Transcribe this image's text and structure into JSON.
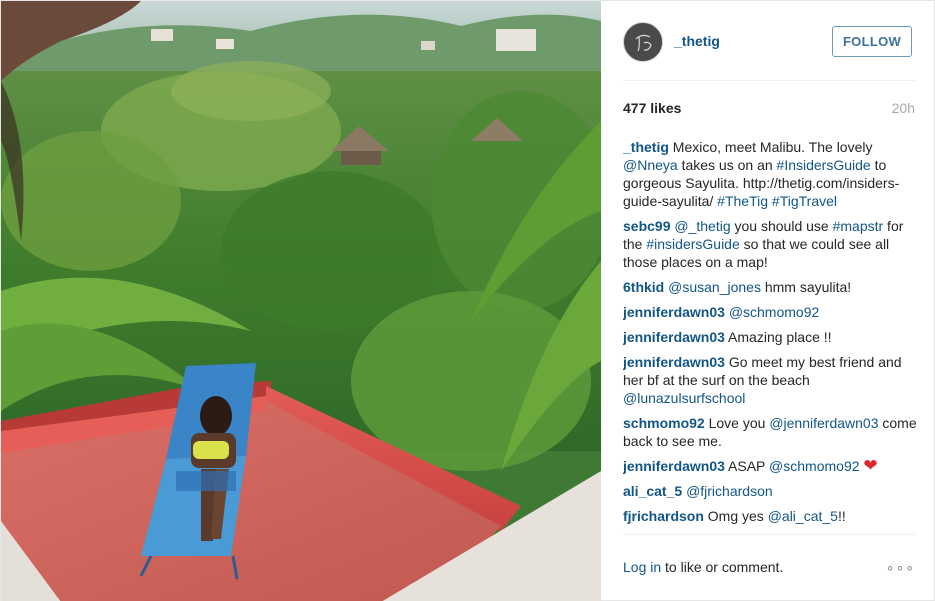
{
  "post": {
    "username": "_thetig",
    "follow_label": "FOLLOW",
    "likes": "477 likes",
    "age": "20h",
    "login_link": "Log in",
    "login_suffix": " to like or comment.",
    "more_glyph": "∘∘∘"
  },
  "comments": [
    {
      "author": "_thetig",
      "parts": [
        {
          "t": "Mexico, meet Malibu. The lovely ",
          "tag": false
        },
        {
          "t": "@Nneya",
          "tag": true
        },
        {
          "t": " takes us on an ",
          "tag": false
        },
        {
          "t": "#InsidersGuide",
          "tag": true
        },
        {
          "t": " to gorgeous Sayulita. http://thetig.com/insiders-guide-sayulita/ ",
          "tag": false
        },
        {
          "t": "#TheTig",
          "tag": true
        },
        {
          "t": " ",
          "tag": false
        },
        {
          "t": "#TigTravel",
          "tag": true
        }
      ]
    },
    {
      "author": "sebc99",
      "parts": [
        {
          "t": "@_thetig",
          "tag": true
        },
        {
          "t": " you should use ",
          "tag": false
        },
        {
          "t": "#mapstr",
          "tag": true
        },
        {
          "t": " for the ",
          "tag": false
        },
        {
          "t": "#insidersGuide",
          "tag": true
        },
        {
          "t": " so that we could see all those places on a map!",
          "tag": false
        }
      ]
    },
    {
      "author": "6thkid",
      "parts": [
        {
          "t": "@susan_jones",
          "tag": true
        },
        {
          "t": " hmm sayulita!",
          "tag": false
        }
      ]
    },
    {
      "author": "jenniferdawn03",
      "parts": [
        {
          "t": "@schmomo92",
          "tag": true
        }
      ]
    },
    {
      "author": "jenniferdawn03",
      "parts": [
        {
          "t": "Amazing place !!",
          "tag": false
        }
      ]
    },
    {
      "author": "jenniferdawn03",
      "parts": [
        {
          "t": "Go meet my best friend and her bf at the surf on the beach ",
          "tag": false
        },
        {
          "t": "@lunazulsurfschool",
          "tag": true
        }
      ]
    },
    {
      "author": "schmomo92",
      "parts": [
        {
          "t": "Love you ",
          "tag": false
        },
        {
          "t": "@jenniferdawn03",
          "tag": true
        },
        {
          "t": " come back to see me.",
          "tag": false
        }
      ]
    },
    {
      "author": "jenniferdawn03",
      "parts": [
        {
          "t": "ASAP ",
          "tag": false
        },
        {
          "t": "@schmomo92",
          "tag": true
        },
        {
          "t": " ",
          "tag": false
        },
        {
          "t": "❤",
          "tag": false,
          "heart": true
        }
      ]
    },
    {
      "author": "ali_cat_5",
      "parts": [
        {
          "t": "@fjrichardson",
          "tag": true
        }
      ]
    },
    {
      "author": "fjrichardson",
      "parts": [
        {
          "t": "Omg yes ",
          "tag": false
        },
        {
          "t": "@ali_cat_5",
          "tag": true
        },
        {
          "t": "!!",
          "tag": false
        }
      ]
    }
  ],
  "icons": {
    "avatar": "thetig-logo-avatar",
    "heart": "heart-emoji"
  },
  "colors": {
    "link_blue": "#125688",
    "follow_text": "#3f729b",
    "follow_border": "#6f97b6",
    "muted_gray": "#a5a7aa",
    "heart_red": "#e0262f"
  }
}
